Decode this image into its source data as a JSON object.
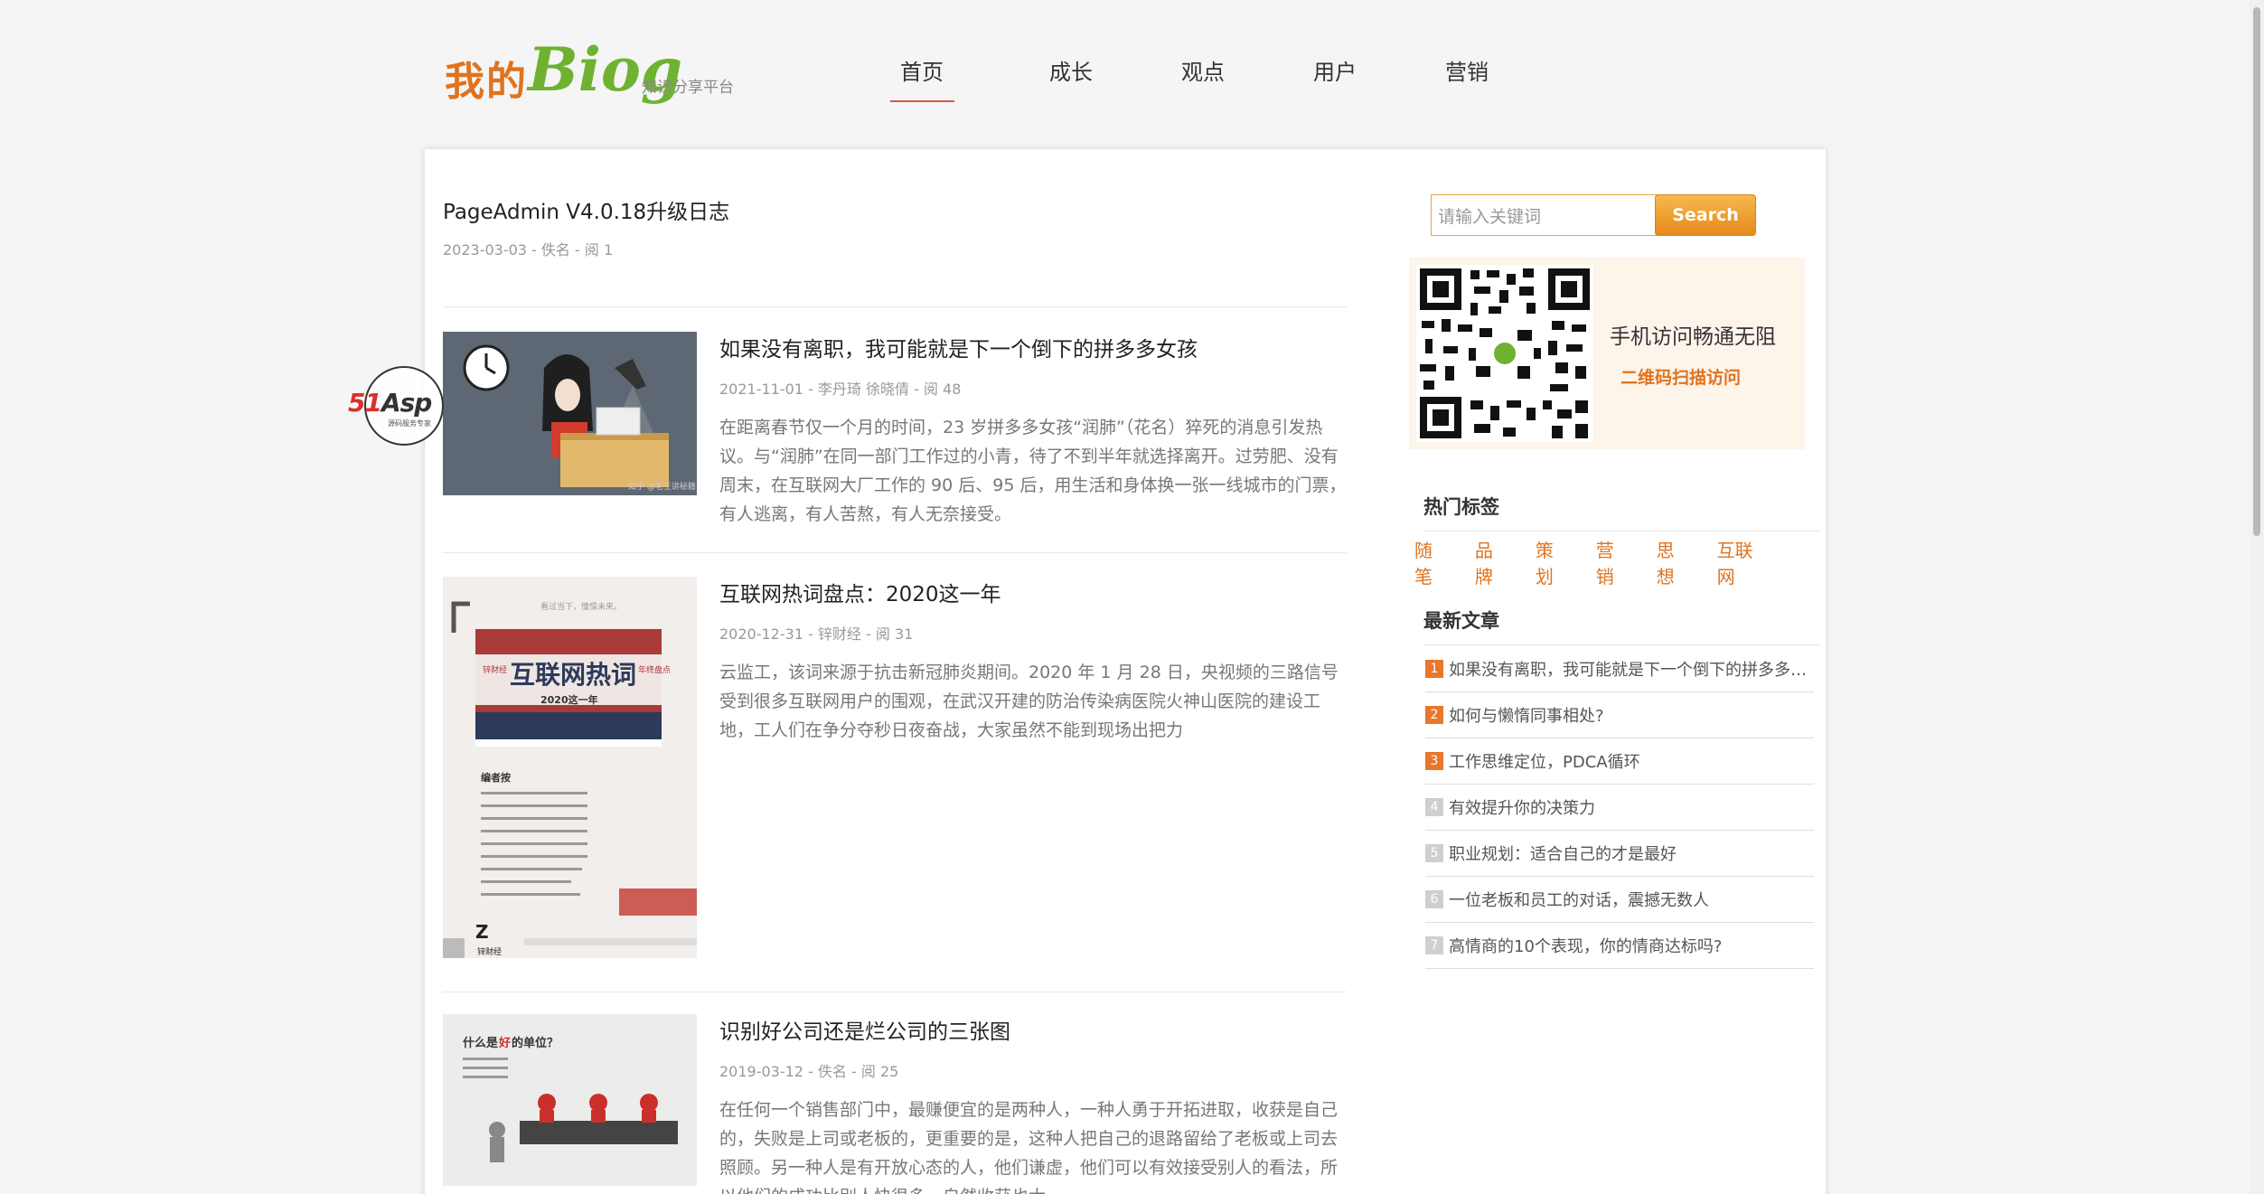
{
  "logo": {
    "cn": "我的",
    "blog": "Biog",
    "subtitle": "知识分享平台"
  },
  "nav": [
    {
      "label": "首页",
      "active": true
    },
    {
      "label": "成长",
      "active": false
    },
    {
      "label": "观点",
      "active": false
    },
    {
      "label": "用户",
      "active": false
    },
    {
      "label": "营销",
      "active": false
    }
  ],
  "main": {
    "top_article": {
      "title": "PageAdmin V4.0.18升级日志",
      "meta": "2023-03-03 - 佚名 - 阅 1"
    },
    "articles": [
      {
        "title": "如果没有离职，我可能就是下一个倒下的拼多多女孩",
        "meta": "2021-11-01 - 李丹琦 徐晓倩 - 阅 48",
        "summary": "在距离春节仅一个月的时间，23 岁拼多多女孩“润肺”（花名）猝死的消息引发热议。与“润肺”在同一部门工作过的小青，待了不到半年就选择离开。过劳肥、没有周末，在互联网大厂工作的 90 后、95 后，用生活和身体换一张一线城市的门票，有人逃离，有人苦熬，有人无奈接受。",
        "thumb_caption": "知乎 @老王讲秘籍"
      },
      {
        "title": "互联网热词盘点：2020这一年",
        "meta": "2020-12-31 - 锌财经 - 阅 31",
        "summary": "云监工，该词来源于抗击新冠肺炎期间。2020 年 1 月 28 日，央视频的三路信号受到很多互联网用户的围观，在武汉开建的防治传染病医院火神山医院的建设工地，工人们在争分夺秒日夜奋战，大家虽然不能到现场出把力",
        "thumb_text": {
          "top": "看过当下，憧憬未来。",
          "left_tag": "锌财经",
          "main": "互联网热词",
          "right_tag": "年终盘点",
          "year": "2020这一年",
          "editor": "编者按",
          "brand": "锌财经"
        }
      },
      {
        "title": "识别好公司还是烂公司的三张图",
        "meta": "2019-03-12 - 佚名 - 阅 25",
        "summary": "在任何一个销售部门中，最赚便宜的是两种人，一种人勇于开拓进取，收获是自己的，失败是上司或老板的，更重要的是，这种人把自己的退路留给了老板或上司去照顾。另一种人是有开放心态的人，他们谦虚，他们可以有效接受别人的看法，所以他们的成功比别人快很多，自然收获也大",
        "thumb_text": {
          "q_pre": "什么是",
          "q_key": "好",
          "q_post": "的单位？"
        }
      }
    ]
  },
  "sidebar": {
    "search": {
      "placeholder": "请输入关键词",
      "button": "Search"
    },
    "qr": {
      "title": "手机访问畅通无阻",
      "subtitle": "二维码扫描访问"
    },
    "hot_tags_title": "热门标签",
    "tags": [
      "随笔",
      "品牌",
      "策划",
      "营销",
      "思想",
      "互联网"
    ],
    "recent_title": "最新文章",
    "recent": [
      {
        "num": "1",
        "title": "如果没有离职，我可能就是下一个倒下的拼多多…"
      },
      {
        "num": "2",
        "title": "如何与懒惰同事相处?"
      },
      {
        "num": "3",
        "title": "工作思维定位，PDCA循环"
      },
      {
        "num": "4",
        "title": "有效提升你的决策力"
      },
      {
        "num": "5",
        "title": "职业规划：适合自己的才是最好"
      },
      {
        "num": "6",
        "title": "一位老板和员工的对话，震撼无数人"
      },
      {
        "num": "7",
        "title": "高情商的10个表现，你的情商达标吗?"
      }
    ]
  },
  "watermark": {
    "text_red": "51",
    "text_dark": "Asp",
    "sub": "源码服务专家"
  },
  "colors": {
    "accent": "#e0731f",
    "nav_underline": "#d9534f",
    "brand_green": "#6fb232"
  }
}
